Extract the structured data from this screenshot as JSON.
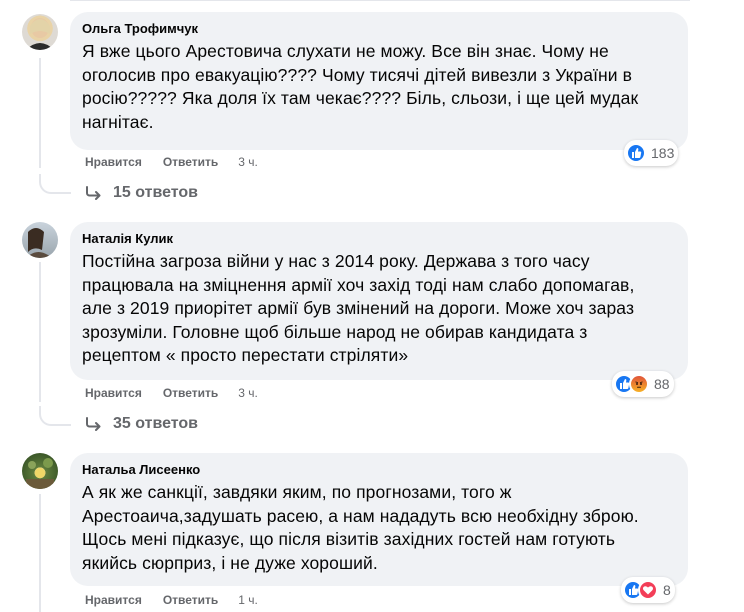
{
  "comments": [
    {
      "author": "Ольга Трофимчук",
      "text": "Я вже цього Арестовича слухати не можу. Все він знає. Чому не\nоголосив про евакуацію???? Чому тисячі дітей вивезли з України в\nросію????? Яка доля їх там чекає???? Біль, сльози, і ще цей мудак\nнагнітає.",
      "like_label": "Нравится",
      "reply_label": "Ответить",
      "time": "3 ч.",
      "reactions": [
        "like"
      ],
      "reaction_count": "183",
      "replies_label": "15 ответов",
      "avatar_color": "#d9d6cf"
    },
    {
      "author": "Наталія Кулик",
      "text": "Постійна загроза війни у нас з 2014 року. Держава з того часу\nпрацювала на зміцнення армії хоч захід тоді нам слабо допомагав,\nале з 2019 приорітет армії був змінений на дороги. Може хоч зараз\nзрозуміли. Головне щоб більше народ не обирав кандидата з\nрецептом « просто перестати стріляти»",
      "like_label": "Нравится",
      "reply_label": "Ответить",
      "time": "3 ч.",
      "reactions": [
        "like",
        "angry"
      ],
      "reaction_count": "88",
      "replies_label": "35 ответов",
      "avatar_color": "#b9c3cc"
    },
    {
      "author": "Натальа Лисеенко",
      "text": "А як же санкції, завдяки яким, по прогнозами, того ж\nАрестоаича,задушать расею, а нам нададуть всю необхідну зброю.\nЩось мені підказує, що після візитів західних гостей нам готують\nякийсь сюрприз, і не дуже хороший.",
      "like_label": "Нравится",
      "reply_label": "Ответить",
      "time": "1 ч.",
      "reactions": [
        "like",
        "love"
      ],
      "reaction_count": "8",
      "avatar_color": "#6f8a4e"
    }
  ],
  "colors": {
    "bubble": "#f0f2f5",
    "meta_text": "#65676b",
    "like_blue": "#1877f2",
    "love_red": "#f33e58"
  },
  "icons": {
    "like": "thumbs-up-icon",
    "angry": "angry-face-icon",
    "love": "heart-icon",
    "reply_arrow": "reply-arrow-icon"
  }
}
